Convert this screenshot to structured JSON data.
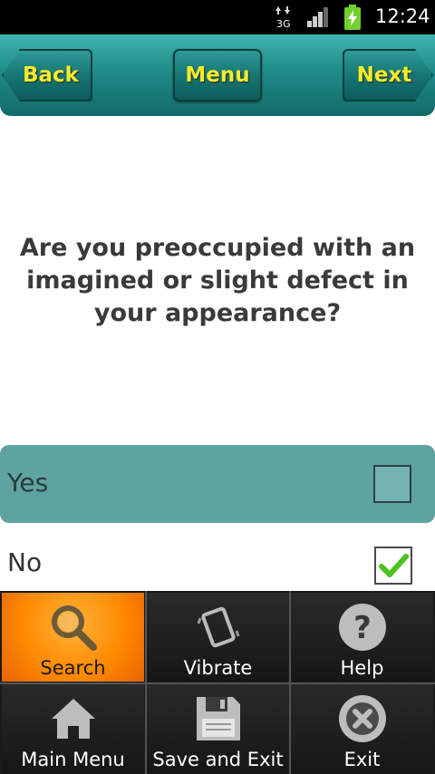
{
  "status_bar": {
    "network": "3G",
    "time": "12:24"
  },
  "nav": {
    "back_label": "Back",
    "menu_label": "Menu",
    "next_label": "Next"
  },
  "question": {
    "text": "Are you preoccupied with an imagined or slight defect in your appearance?"
  },
  "options": [
    {
      "label": "Yes",
      "checked": false
    },
    {
      "label": "No",
      "checked": true
    }
  ],
  "menu": {
    "items": [
      {
        "label": "Search",
        "icon": "search-icon"
      },
      {
        "label": "Vibrate",
        "icon": "vibrate-icon"
      },
      {
        "label": "Help",
        "icon": "help-icon"
      },
      {
        "label": "Main Menu",
        "icon": "home-icon"
      },
      {
        "label": "Save and Exit",
        "icon": "floppy-disk-icon"
      },
      {
        "label": "Exit",
        "icon": "exit-icon"
      }
    ]
  },
  "colors": {
    "nav_teal": "#1f8c88",
    "button_text": "#f7ec2a",
    "selected_option": "#5fa3a1",
    "menu_highlight": "#ff8a00",
    "check_green": "#4cc21e"
  }
}
